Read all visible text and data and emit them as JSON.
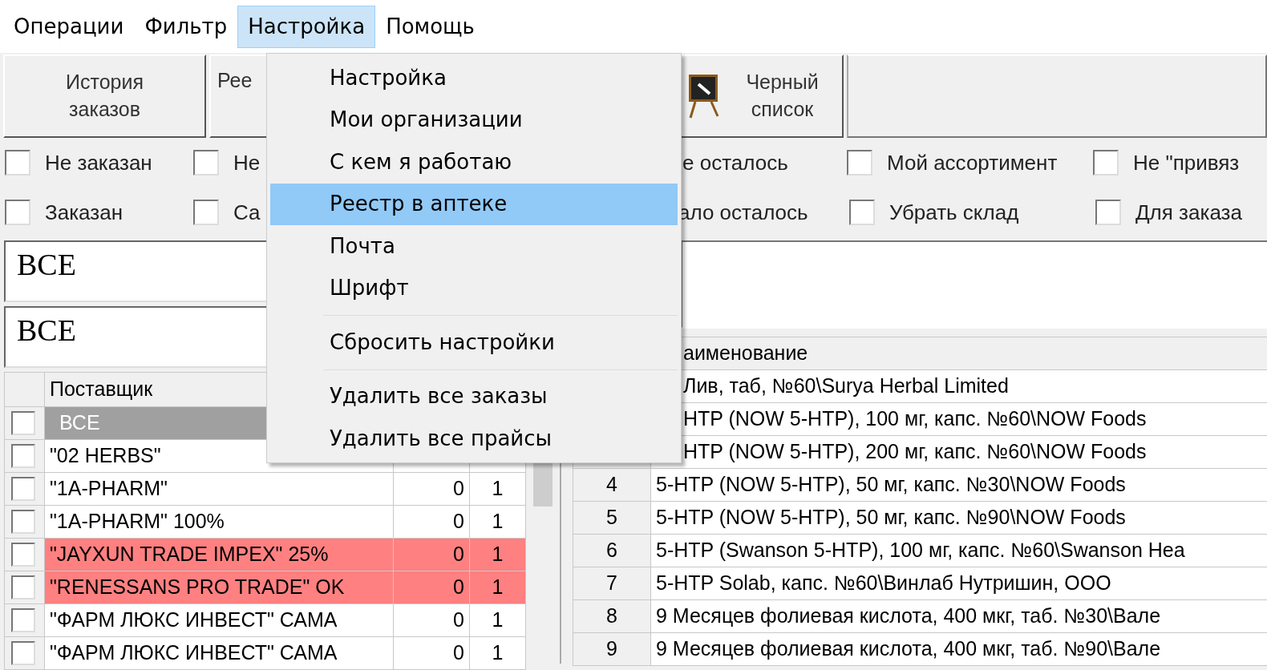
{
  "menu_bar": [
    {
      "label": "Операции",
      "selected": false
    },
    {
      "label": "Фильтр",
      "selected": false
    },
    {
      "label": "Настройка",
      "selected": true
    },
    {
      "label": "Помощь",
      "selected": false
    }
  ],
  "open_menu": {
    "items": [
      {
        "kind": "item",
        "label": "Настройка",
        "selected": false
      },
      {
        "kind": "item",
        "label": "Мои организации",
        "selected": false
      },
      {
        "kind": "item",
        "label": "С кем я работаю",
        "selected": false
      },
      {
        "kind": "item",
        "label": "Реестр в аптеке",
        "selected": true
      },
      {
        "kind": "item",
        "label": "Почта",
        "selected": false
      },
      {
        "kind": "item",
        "label": "Шрифт",
        "selected": false
      },
      {
        "kind": "separator"
      },
      {
        "kind": "item",
        "label": "Сбросить настройки",
        "selected": false
      },
      {
        "kind": "separator"
      },
      {
        "kind": "item",
        "label": "Удалить все заказы",
        "selected": false
      },
      {
        "kind": "item",
        "label": "Удалить все прайсы",
        "selected": false
      }
    ]
  },
  "toolbar": [
    {
      "kind": "text",
      "label": "История заказов"
    },
    {
      "kind": "text",
      "label": "Рее"
    },
    {
      "kind": "icon",
      "label": "Черный список"
    }
  ],
  "filters": [
    [
      {
        "label": "Не заказан",
        "checked": false
      },
      {
        "label": "Не",
        "checked": false
      },
      {
        "label": "е осталось"
      },
      {
        "label": "Мой ассортимент",
        "checked": false
      },
      {
        "label": "Не \"привяз",
        "checked": false
      }
    ],
    [
      {
        "label": "Заказан",
        "checked": false
      },
      {
        "label": "Са",
        "checked": false
      },
      {
        "label": "ало осталось"
      },
      {
        "label": "Убрать склад",
        "checked": false
      },
      {
        "label": "Для заказа",
        "checked": false
      }
    ]
  ],
  "filter_boxes": [
    "ВСЕ",
    "ВСЕ"
  ],
  "suppliers": {
    "columns": [
      "Поставщик"
    ],
    "rows": [
      {
        "name": "ВСЕ",
        "checked": false,
        "selected": true,
        "highlighted": false
      },
      {
        "name": "\"02 HERBS\"",
        "checked": false,
        "selected": false,
        "highlighted": false
      },
      {
        "name": "\"1A-PHARM\"",
        "checked": false,
        "selected": false,
        "highlighted": false,
        "column_2": "0",
        "column_3": "1"
      },
      {
        "name": "\"1A-PHARM\" 100%",
        "checked": false,
        "selected": false,
        "highlighted": false,
        "column_2": "0",
        "column_3": "1"
      },
      {
        "name": "\"JAYXUN TRADE IMPEX\" 25%",
        "checked": false,
        "selected": false,
        "highlighted": true,
        "column_2": "0",
        "column_3": "1"
      },
      {
        "name": "\"RENESSANS PRO TRADE\" OK",
        "checked": false,
        "selected": false,
        "highlighted": true,
        "column_2": "0",
        "column_3": "1"
      },
      {
        "name": "\"ФАРМ ЛЮКС ИНВЕСТ\" САМА",
        "checked": false,
        "selected": false,
        "highlighted": false,
        "column_2": "0",
        "column_3": "1"
      },
      {
        "name": "\"ФАРМ ЛЮКС ИНВЕСТ\" САМА",
        "checked": false,
        "selected": false,
        "highlighted": false,
        "column_2": "0",
        "column_3": "1"
      }
    ]
  },
  "products": {
    "columns": [
      "аименование"
    ],
    "rows": [
      {
        "name": "Лив, таб, №60\\Surya Herbal Limited"
      },
      {
        "name": "HTP (NOW 5-HTP), 100 мг, капс. №60\\NOW Foods"
      },
      {
        "name": "HTP (NOW 5-HTP), 200 мг, капс. №60\\NOW Foods"
      },
      {
        "number": "4",
        "name": "5-HTP (NOW 5-HTP), 50 мг, капс. №30\\NOW Foods"
      },
      {
        "number": "5",
        "name": "5-HTP (NOW 5-HTP), 50 мг, капс. №90\\NOW Foods"
      },
      {
        "number": "6",
        "name": "5-HTP (Swanson 5-HTP), 100 мг, капс. №60\\Swanson Hea"
      },
      {
        "number": "7",
        "name": "5-HTP Solab, капс. №60\\Винлаб Нутришин, ООО"
      },
      {
        "number": "8",
        "name": "9 Месяцев фолиевая кислота, 400 мкг, таб. №30\\Вале"
      },
      {
        "number": "9",
        "name": "9 Месяцев фолиевая кислота, 400 мкг, таб. №90\\Вале"
      }
    ]
  }
}
